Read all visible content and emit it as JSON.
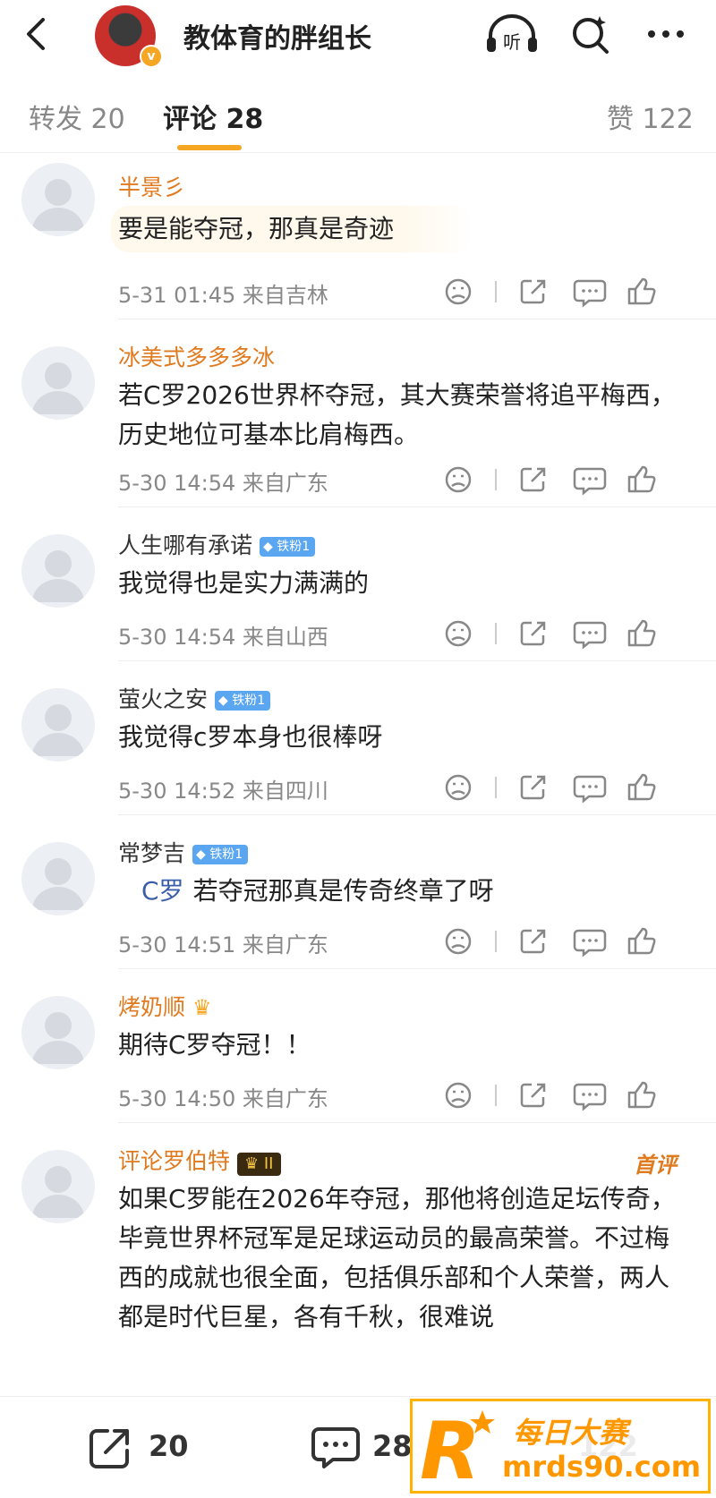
{
  "header": {
    "title": "教体育的胖组长",
    "verified_mark": "v",
    "icons": [
      "back-arrow-icon",
      "headphones-listen-icon",
      "search-sparkle-icon",
      "more-dots-icon"
    ],
    "listen_label": "听"
  },
  "tabs": {
    "repost": "转发 20",
    "comment": "评论 28",
    "like": "赞 122"
  },
  "comments": [
    {
      "name": "半景彡",
      "text": "要是能夺冠，那真是奇迹",
      "meta": "5-31 01:45  来自吉林"
    },
    {
      "name": "冰美式多多多冰",
      "text": "若C罗2026世界杯夺冠，其大赛荣誉将追平梅西，历史地位可基本比肩梅西。",
      "meta": "5-30 14:54  来自广东"
    },
    {
      "name": "人生哪有承诺",
      "badge": "铁粉1",
      "text": "我觉得也是实力满满的",
      "meta": "5-30 14:54  来自山西"
    },
    {
      "name": "萤火之安",
      "badge": "铁粉1",
      "text": "我觉得c罗本身也很棒呀",
      "meta": "5-30 14:52  来自四川"
    },
    {
      "name": "常梦吉",
      "badge": "铁粉1",
      "tag": "C罗",
      "text": "若夺冠那真是传奇终章了呀",
      "meta": "5-30 14:51  来自广东"
    },
    {
      "name": "烤奶顺",
      "text": "期待C罗夺冠！！",
      "meta": "5-30 14:50  来自广东"
    },
    {
      "name": "评论罗伯特",
      "level": "II",
      "first_label": "首评",
      "text": "如果C罗能在2026年夺冠，那他将创造足坛传奇，毕竟世界杯冠军是足球运动员的最高荣誉。不过梅西的成就也很全面，包括俱乐部和个人荣誉，两人都是时代巨星，各有千秋，很难说"
    }
  ],
  "bottom_bar": {
    "repost_count": "20",
    "comment_count": "28",
    "like_count": "122"
  },
  "watermark": {
    "brand": "每日大赛",
    "site": "mrds90.com"
  },
  "colors": {
    "accent": "#f5a623",
    "name_orange": "#e07a1f",
    "badge_blue": "#5aa6f0"
  }
}
